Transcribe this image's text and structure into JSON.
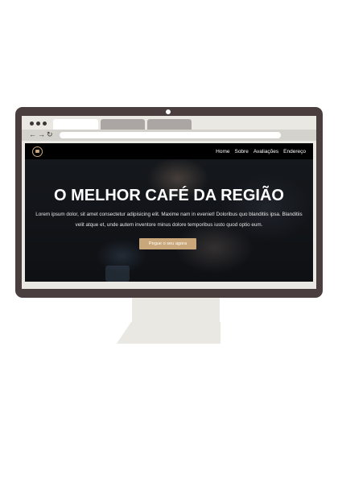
{
  "browser": {
    "icons": [
      "back-arrow-icon",
      "forward-arrow-icon",
      "reload-icon"
    ],
    "url": ""
  },
  "site": {
    "nav": {
      "home": "Home",
      "sobre": "Sobre",
      "avaliacoes": "Avaliações",
      "endereco": "Endereço"
    },
    "hero": {
      "title": "O MELHOR CAFÉ DA REGIÃO",
      "text": "Lorem ipsum dolor, sit amet consectetur adipisicing elit. Maxime nam in eveniet! Doloribus quo blanditiis ipsa. Blanditiis velit atque et, unde autem inventore minus dolore temporibus iusto quod optio eum.",
      "cta": "Pegue o seu agora"
    }
  },
  "colors": {
    "monitor_frame": "#4a3f3e",
    "accent": "#c9a77a",
    "header_bg": "#000000",
    "browser_chrome": "#e9e8e3"
  }
}
